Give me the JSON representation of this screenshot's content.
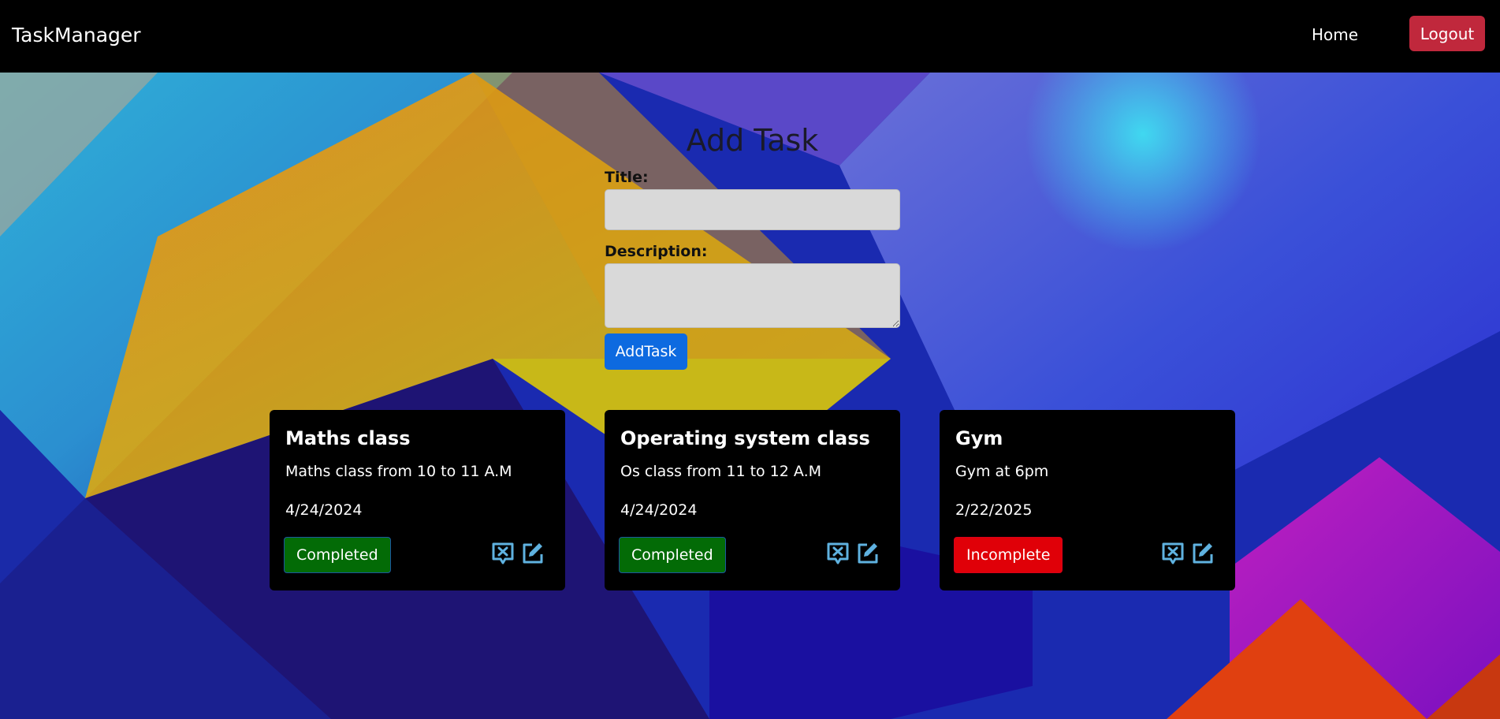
{
  "navbar": {
    "brand": "TaskManager",
    "home_label": "Home",
    "logout_label": "Logout"
  },
  "form": {
    "title": "Add Task",
    "title_label": "Title:",
    "title_value": "",
    "description_label": "Description:",
    "description_value": "",
    "submit_label": "AddTask"
  },
  "tasks": [
    {
      "title": "Maths class",
      "description": "Maths class from 10 to 11 A.M",
      "date": "4/24/2024",
      "status": "Completed"
    },
    {
      "title": "Operating system class",
      "description": "Os class from 11 to 12 A.M",
      "date": "4/24/2024",
      "status": "Completed"
    },
    {
      "title": "Gym",
      "description": "Gym at 6pm",
      "date": "2/22/2025",
      "status": "Incomplete"
    }
  ],
  "icons": {
    "delete": "delete-task-icon",
    "edit": "edit-task-icon"
  },
  "colors": {
    "completed": "#036b06",
    "incomplete": "#e00008",
    "logout": "#c0283c",
    "add_button": "#0d6ae0",
    "icon": "#5fb2e0"
  }
}
